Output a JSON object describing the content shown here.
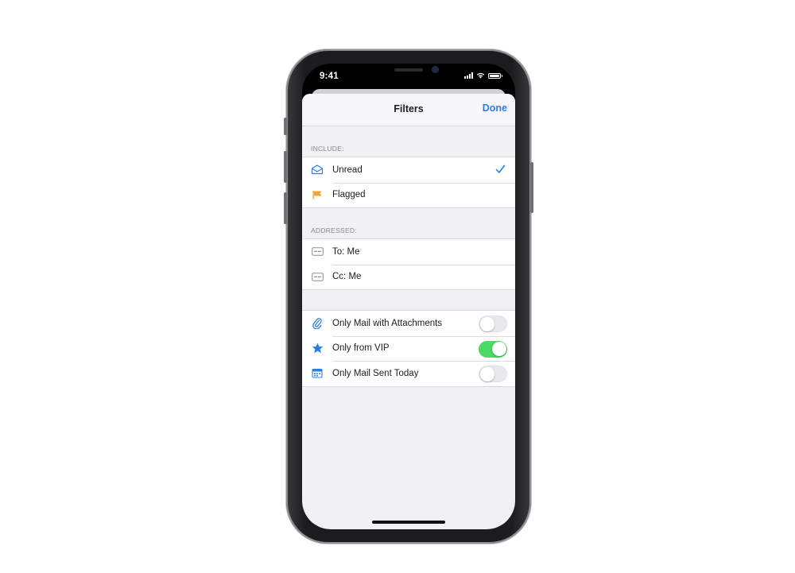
{
  "status_bar": {
    "time": "9:41"
  },
  "sheet": {
    "title": "Filters",
    "done_label": "Done"
  },
  "include_section": {
    "header": "INCLUDE:",
    "items": [
      {
        "label": "Unread",
        "icon": "envelope-icon",
        "checked": true
      },
      {
        "label": "Flagged",
        "icon": "flag-icon",
        "checked": false
      }
    ]
  },
  "addressed_section": {
    "header": "ADDRESSED:",
    "items": [
      {
        "label": "To: Me",
        "icon": "to-badge-icon"
      },
      {
        "label": "Cc: Me",
        "icon": "cc-badge-icon"
      }
    ]
  },
  "options_section": {
    "items": [
      {
        "label": "Only Mail with Attachments",
        "icon": "paperclip-icon",
        "enabled": false
      },
      {
        "label": "Only from VIP",
        "icon": "star-icon",
        "enabled": true
      },
      {
        "label": "Only Mail Sent Today",
        "icon": "calendar-icon",
        "enabled": false
      }
    ]
  },
  "colors": {
    "accent": "#2f7de1",
    "toggle_on": "#4cd964",
    "flag": "#f2a33a",
    "background": "#f0f0f5"
  }
}
